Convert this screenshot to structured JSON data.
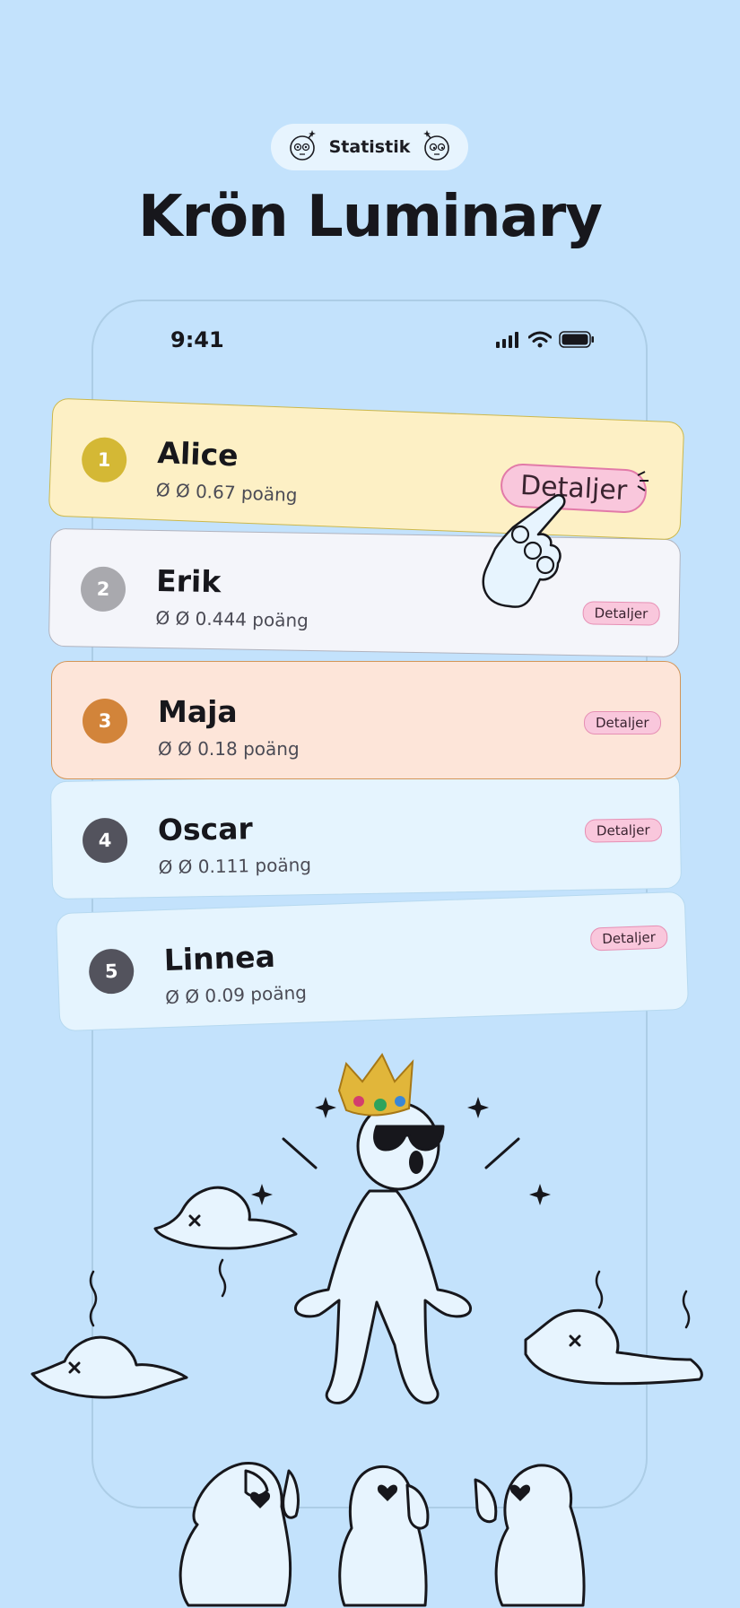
{
  "badge": {
    "label": "Statistik"
  },
  "title": "Krön Luminary",
  "status_bar": {
    "time": "9:41"
  },
  "leaderboard": [
    {
      "rank": "1",
      "name": "Alice",
      "score": "Ø Ø 0.67 poäng",
      "button": "Detaljer",
      "color": "#D4B835"
    },
    {
      "rank": "2",
      "name": "Erik",
      "score": "Ø Ø 0.444 poäng",
      "button": "Detaljer",
      "color": "#A9A9AE"
    },
    {
      "rank": "3",
      "name": "Maja",
      "score": "Ø Ø 0.18 poäng",
      "button": "Detaljer",
      "color": "#D2843A"
    },
    {
      "rank": "4",
      "name": "Oscar",
      "score": "Ø Ø 0.111 poäng",
      "button": "Detaljer",
      "color": "#53535D"
    },
    {
      "rank": "5",
      "name": "Linnea",
      "score": "Ø Ø 0.09 poäng",
      "button": "Detaljer",
      "color": "#53535D"
    }
  ],
  "colors": {
    "background": "#C3E2FC",
    "accent_pink": "#F9C7DC",
    "figure_fill": "#E7F4FE"
  },
  "icons": [
    "bomb-face-icon",
    "signal-icon",
    "wifi-icon",
    "battery-icon",
    "pointing-hand-icon",
    "crown-icon"
  ]
}
